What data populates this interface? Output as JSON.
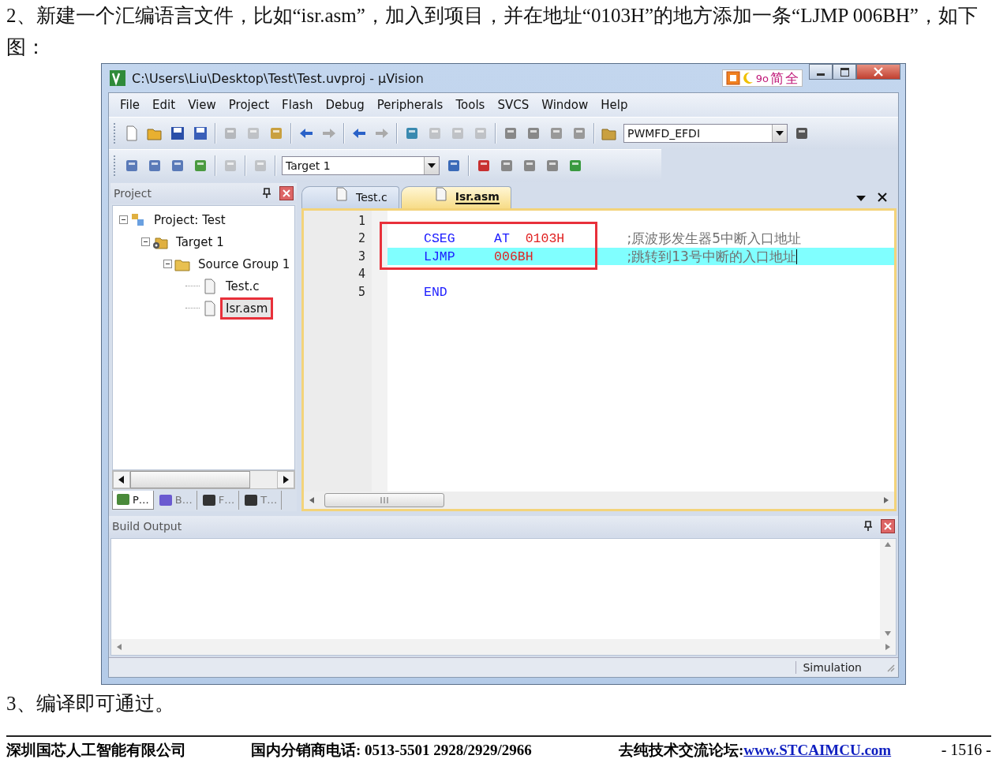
{
  "intro": "2、新建一个汇编语言文件，比如“isr.asm”，加入到项目，并在地址“0103H”的地方添加一条“LJMP 006BH”，如下图：",
  "window": {
    "title": "C:\\Users\\Liu\\Desktop\\Test\\Test.uvproj - µVision",
    "ime": [
      "9o",
      "简",
      "全"
    ]
  },
  "menu": [
    "File",
    "Edit",
    "View",
    "Project",
    "Flash",
    "Debug",
    "Peripherals",
    "Tools",
    "SVCS",
    "Window",
    "Help"
  ],
  "toolbar": {
    "device_combo": "PWMFD_EFDI",
    "target_combo": "Target 1"
  },
  "project_panel": {
    "title": "Project",
    "tree": [
      {
        "label": "Project: Test",
        "kind": "project",
        "expanded": true,
        "selected": false,
        "annotated": false,
        "children": [
          {
            "label": "Target 1",
            "kind": "target",
            "expanded": true,
            "selected": false,
            "annotated": false,
            "children": [
              {
                "label": "Source Group 1",
                "kind": "group",
                "expanded": true,
                "selected": false,
                "annotated": false,
                "children": [
                  {
                    "label": "Test.c",
                    "kind": "file",
                    "selected": false,
                    "annotated": false
                  },
                  {
                    "label": "Isr.asm",
                    "kind": "file",
                    "selected": true,
                    "annotated": true
                  }
                ]
              }
            ]
          }
        ]
      }
    ],
    "tabs": [
      {
        "label": "P…",
        "kind": "project",
        "selected": true
      },
      {
        "label": "B…",
        "kind": "books",
        "selected": false
      },
      {
        "label": "F…",
        "kind": "functions",
        "selected": false
      },
      {
        "label": "T…",
        "kind": "templates",
        "selected": false
      }
    ]
  },
  "editor": {
    "tabs": [
      {
        "label": "Test.c",
        "selected": false
      },
      {
        "label": "Isr.asm",
        "selected": true
      }
    ],
    "lines": [
      {
        "number": "1",
        "current": false,
        "annotated": false
      },
      {
        "number": "2",
        "mnemonic": "CSEG",
        "operands": [
          {
            "text": "AT",
            "kind": "keyword"
          },
          {
            "text": "0103H",
            "kind": "number"
          }
        ],
        "comment": ";原波形发生器5中断入口地址",
        "current": false,
        "annotated": true
      },
      {
        "number": "3",
        "mnemonic": "LJMP",
        "operands": [
          {
            "text": "006BH",
            "kind": "number"
          }
        ],
        "comment": ";跳转到13号中断的入口地址",
        "current": true,
        "annotated": true
      },
      {
        "number": "4",
        "current": false,
        "annotated": false
      },
      {
        "number": "5",
        "mnemonic": "END",
        "current": false,
        "annotated": false
      }
    ]
  },
  "build_output": {
    "title": "Build Output"
  },
  "status_bar": {
    "mode": "Simulation"
  },
  "after_text": "3、编译即可通过。",
  "footer": {
    "company": "深圳国芯人工智能有限公司",
    "phone": "国内分销商电话: 0513-5501 2928/2929/2966",
    "forum_label": "去纯技术交流论坛:",
    "forum_link": "www.STCAIMCU.com",
    "page": "- 1516 -"
  }
}
